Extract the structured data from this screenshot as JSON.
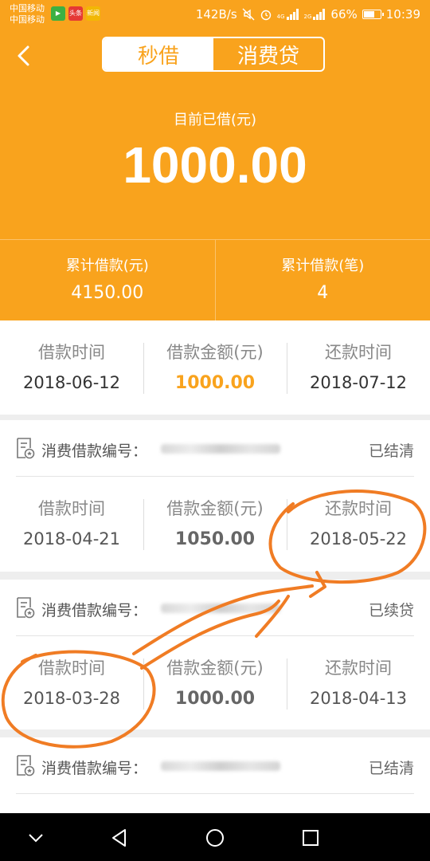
{
  "status_bar": {
    "carrier_1": "中国移动",
    "carrier_2": "中国移动",
    "app_icons": [
      {
        "icon": "video-app-icon",
        "color": "#3cb043",
        "text": "▶"
      },
      {
        "icon": "toutiao-app-icon",
        "color": "#e53935",
        "text": "头条"
      },
      {
        "icon": "news-app-icon",
        "color": "#f2b705",
        "text": "新闻"
      }
    ],
    "net_speed": "142B/s",
    "signal_labels": [
      "4G",
      "2G"
    ],
    "battery": "66%",
    "battery_level": 0.66,
    "time": "10:39"
  },
  "header": {
    "tabs": [
      {
        "label": "秒借",
        "active": true
      },
      {
        "label": "消费贷",
        "active": false
      }
    ],
    "current_label": "目前已借(元)",
    "current_amount": "1000.00"
  },
  "summary": [
    {
      "label": "累计借款(元)",
      "value": "4150.00"
    },
    {
      "label": "累计借款(笔)",
      "value": "4"
    }
  ],
  "columns": {
    "borrow_time": "借款时间",
    "amount": "借款金额(元)",
    "repay_time": "还款时间"
  },
  "current_loan": {
    "borrow_date": "2018-06-12",
    "amount": "1000.00",
    "repay_date": "2018-07-12"
  },
  "records": [
    {
      "number_label": "消费借款编号：",
      "status": "已结清",
      "borrow_date": "2018-04-21",
      "amount": "1050.00",
      "repay_date": "2018-05-22"
    },
    {
      "number_label": "消费借款编号：",
      "status": "已续贷",
      "borrow_date": "2018-03-28",
      "amount": "1000.00",
      "repay_date": "2018-04-13"
    },
    {
      "number_label": "消费借款编号：",
      "status": "已结清"
    }
  ],
  "colors": {
    "accent": "#f9a31d",
    "annotation": "#f07c24"
  }
}
